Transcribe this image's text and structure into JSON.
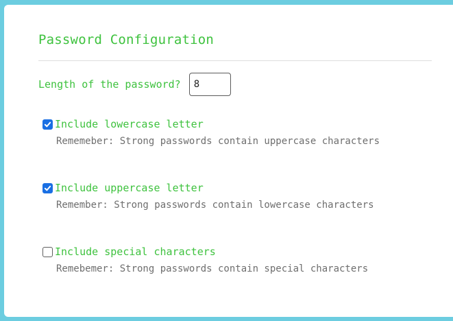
{
  "form": {
    "title": "Password Configuration",
    "length": {
      "label": "Length of the password?",
      "value": "8"
    },
    "options": [
      {
        "label": "Include lowercase letter",
        "checked": true,
        "hint": "Rememeber: Strong passwords contain uppercase characters"
      },
      {
        "label": "Include uppercase letter",
        "checked": true,
        "hint": "Remember: Strong passwords contain lowercase characters"
      },
      {
        "label": "Include special characters",
        "checked": false,
        "hint": "Remebemer: Strong passwords contain special characters"
      }
    ]
  },
  "colors": {
    "background": "#6ccde0",
    "accent_text": "#3ec23e",
    "checkbox_checked": "#1a6fe3",
    "hint_text": "#6e6e6e"
  }
}
